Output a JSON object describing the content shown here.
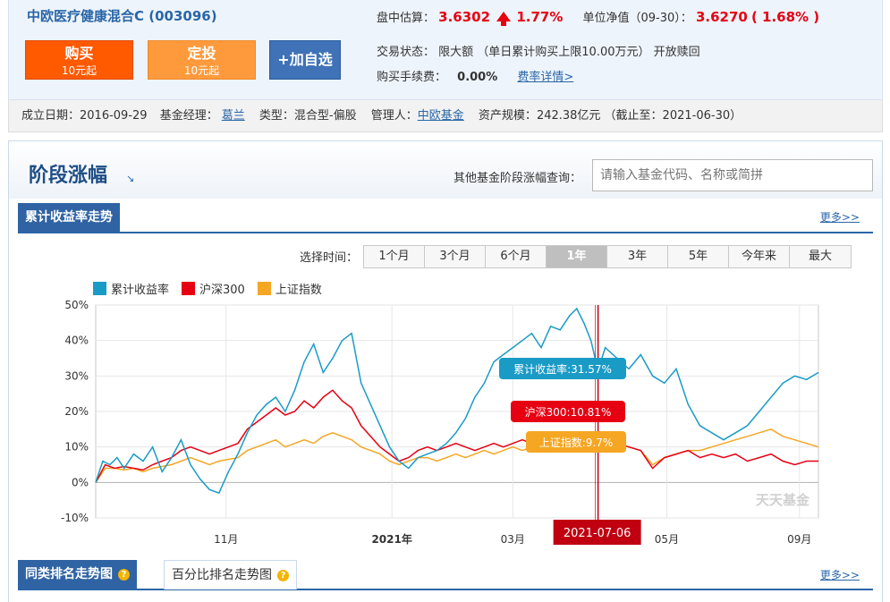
{
  "header": {
    "fund_title": "中欧医疗健康混合C (003096)",
    "buy": {
      "label": "购买",
      "sub": "10元起"
    },
    "sip": {
      "label": "定投",
      "sub": "10元起"
    },
    "add_watch": "+加自选",
    "estimate": {
      "label": "盘中估算：",
      "value": "3.6302",
      "pct": "1.77%"
    },
    "nav": {
      "label": "单位净值（09-30）：",
      "value": "3.6270",
      "pct": "( 1.68% )"
    },
    "trade_status": {
      "label": "交易状态：",
      "value": "限大额 （单日累计购买上限10.00万元） 开放赎回"
    },
    "fee": {
      "label": "购买手续费：",
      "value": "0.00%",
      "link": "费率详情>"
    }
  },
  "subbar": {
    "found_label": "成立日期：",
    "found_value": "2016-09-29",
    "manager_label": "基金经理：",
    "manager_value": "葛兰",
    "type_label": "类型：",
    "type_value": "混合型-偏股",
    "company_label": "管理人：",
    "company_value": "中欧基金",
    "size_label": "资产规模：",
    "size_value": "242.38亿元 （截止至：2021-06-30）"
  },
  "section": {
    "title": "阶段涨幅",
    "title_arrow": "↘",
    "query_label": "其他基金阶段涨幅查询：",
    "query_placeholder": "请输入基金代码、名称或简拼",
    "tab_cumulative": "累计收益率走势",
    "more1": "更多>>",
    "period_label": "选择时间：",
    "periods": [
      "1个月",
      "3个月",
      "6个月",
      "1年",
      "3年",
      "5年",
      "今年来",
      "最大"
    ],
    "active_period": "1年",
    "tab_rank": "同类排名走势图",
    "tab_percent": "百分比排名走势图",
    "more2": "更多>>"
  },
  "colors": {
    "fund": "#1a9bc6",
    "hs300": "#e60012",
    "sz": "#f5a623",
    "accent": "#2f63a3"
  },
  "chart_data": {
    "type": "line",
    "ylim": [
      -10,
      50
    ],
    "yticks": [
      "-10%",
      "0%",
      "10%",
      "20%",
      "30%",
      "40%",
      "50%"
    ],
    "xticks": [
      "11月",
      "2021年",
      "03月",
      "05月",
      "09月"
    ],
    "hover_date": "2021-07-06",
    "watermark": "天天基金",
    "series": [
      {
        "name": "累计收益率",
        "tooltip": "累计收益率:31.57%",
        "points": [
          [
            0,
            0
          ],
          [
            3,
            6
          ],
          [
            6,
            5
          ],
          [
            9,
            7
          ],
          [
            12,
            4
          ],
          [
            16,
            8
          ],
          [
            20,
            6
          ],
          [
            24,
            10
          ],
          [
            28,
            3
          ],
          [
            32,
            7
          ],
          [
            36,
            12
          ],
          [
            40,
            5
          ],
          [
            44,
            1
          ],
          [
            48,
            -2
          ],
          [
            52,
            -3
          ],
          [
            56,
            3
          ],
          [
            60,
            8
          ],
          [
            64,
            14
          ],
          [
            68,
            19
          ],
          [
            72,
            22
          ],
          [
            76,
            24
          ],
          [
            80,
            20
          ],
          [
            84,
            26
          ],
          [
            88,
            34
          ],
          [
            92,
            39
          ],
          [
            96,
            31
          ],
          [
            100,
            35
          ],
          [
            104,
            40
          ],
          [
            108,
            42
          ],
          [
            112,
            28
          ],
          [
            116,
            22
          ],
          [
            120,
            16
          ],
          [
            124,
            10
          ],
          [
            128,
            6
          ],
          [
            132,
            4
          ],
          [
            136,
            7
          ],
          [
            140,
            8
          ],
          [
            144,
            9
          ],
          [
            148,
            11
          ],
          [
            152,
            14
          ],
          [
            156,
            18
          ],
          [
            160,
            24
          ],
          [
            164,
            28
          ],
          [
            168,
            34
          ],
          [
            172,
            36
          ],
          [
            176,
            38
          ],
          [
            180,
            40
          ],
          [
            184,
            42
          ],
          [
            188,
            38
          ],
          [
            192,
            44
          ],
          [
            196,
            43
          ],
          [
            200,
            47
          ],
          [
            203,
            49
          ],
          [
            206,
            45
          ],
          [
            209,
            40
          ],
          [
            212,
            31.5
          ],
          [
            215,
            38
          ],
          [
            220,
            35
          ],
          [
            225,
            32
          ],
          [
            230,
            36
          ],
          [
            235,
            30
          ],
          [
            240,
            28
          ],
          [
            245,
            32
          ],
          [
            250,
            22
          ],
          [
            255,
            16
          ],
          [
            260,
            14
          ],
          [
            265,
            12
          ],
          [
            270,
            14
          ],
          [
            275,
            16
          ],
          [
            280,
            20
          ],
          [
            285,
            24
          ],
          [
            290,
            28
          ],
          [
            295,
            30
          ],
          [
            300,
            29
          ],
          [
            305,
            31
          ]
        ]
      },
      {
        "name": "沪深300",
        "tooltip": "沪深300:10.81%",
        "points": [
          [
            0,
            0
          ],
          [
            4,
            5
          ],
          [
            8,
            4
          ],
          [
            12,
            4.5
          ],
          [
            16,
            4
          ],
          [
            20,
            3.5
          ],
          [
            24,
            5
          ],
          [
            28,
            6
          ],
          [
            32,
            7
          ],
          [
            36,
            9
          ],
          [
            40,
            10
          ],
          [
            44,
            9
          ],
          [
            48,
            8
          ],
          [
            52,
            9
          ],
          [
            56,
            10
          ],
          [
            60,
            11
          ],
          [
            64,
            15
          ],
          [
            68,
            17
          ],
          [
            72,
            19
          ],
          [
            76,
            21
          ],
          [
            80,
            19
          ],
          [
            84,
            20
          ],
          [
            88,
            23
          ],
          [
            92,
            21
          ],
          [
            96,
            24
          ],
          [
            100,
            26
          ],
          [
            104,
            23
          ],
          [
            108,
            21
          ],
          [
            112,
            16
          ],
          [
            116,
            13
          ],
          [
            120,
            10
          ],
          [
            124,
            8
          ],
          [
            128,
            6
          ],
          [
            132,
            7
          ],
          [
            136,
            9
          ],
          [
            140,
            10
          ],
          [
            144,
            9
          ],
          [
            148,
            10
          ],
          [
            152,
            11
          ],
          [
            156,
            10
          ],
          [
            160,
            9
          ],
          [
            164,
            10
          ],
          [
            168,
            11
          ],
          [
            172,
            10
          ],
          [
            176,
            11
          ],
          [
            180,
            12
          ],
          [
            184,
            11
          ],
          [
            188,
            12
          ],
          [
            192,
            11
          ],
          [
            196,
            10
          ],
          [
            200,
            11
          ],
          [
            204,
            12
          ],
          [
            208,
            11
          ],
          [
            212,
            10.8
          ],
          [
            216,
            10
          ],
          [
            220,
            11
          ],
          [
            225,
            10
          ],
          [
            230,
            9
          ],
          [
            235,
            4
          ],
          [
            240,
            7
          ],
          [
            245,
            8
          ],
          [
            250,
            9
          ],
          [
            255,
            7
          ],
          [
            260,
            8
          ],
          [
            265,
            7
          ],
          [
            270,
            8
          ],
          [
            275,
            6
          ],
          [
            280,
            7
          ],
          [
            285,
            8
          ],
          [
            290,
            6
          ],
          [
            295,
            5
          ],
          [
            300,
            6
          ],
          [
            305,
            6
          ]
        ]
      },
      {
        "name": "上证指数",
        "tooltip": "上证指数:9.7%",
        "points": [
          [
            0,
            0
          ],
          [
            4,
            4
          ],
          [
            8,
            4
          ],
          [
            12,
            3.5
          ],
          [
            16,
            4
          ],
          [
            20,
            3
          ],
          [
            24,
            4
          ],
          [
            28,
            4.5
          ],
          [
            32,
            5
          ],
          [
            36,
            6
          ],
          [
            40,
            7
          ],
          [
            44,
            6
          ],
          [
            48,
            5
          ],
          [
            52,
            6
          ],
          [
            56,
            6.5
          ],
          [
            60,
            7
          ],
          [
            64,
            9
          ],
          [
            68,
            10
          ],
          [
            72,
            11
          ],
          [
            76,
            12
          ],
          [
            80,
            10
          ],
          [
            84,
            11
          ],
          [
            88,
            12
          ],
          [
            92,
            11
          ],
          [
            96,
            13
          ],
          [
            100,
            14
          ],
          [
            104,
            13
          ],
          [
            108,
            12
          ],
          [
            112,
            10
          ],
          [
            116,
            9
          ],
          [
            120,
            8
          ],
          [
            124,
            6
          ],
          [
            128,
            5
          ],
          [
            132,
            6
          ],
          [
            136,
            7
          ],
          [
            140,
            7
          ],
          [
            144,
            6
          ],
          [
            148,
            7
          ],
          [
            152,
            8
          ],
          [
            156,
            7
          ],
          [
            160,
            8
          ],
          [
            164,
            9
          ],
          [
            168,
            8
          ],
          [
            172,
            9
          ],
          [
            176,
            10
          ],
          [
            180,
            9
          ],
          [
            184,
            10
          ],
          [
            188,
            11
          ],
          [
            192,
            10
          ],
          [
            196,
            9
          ],
          [
            200,
            10
          ],
          [
            204,
            11
          ],
          [
            208,
            10
          ],
          [
            212,
            9.7
          ],
          [
            216,
            10
          ],
          [
            220,
            11
          ],
          [
            225,
            10
          ],
          [
            230,
            9
          ],
          [
            235,
            5
          ],
          [
            240,
            7
          ],
          [
            245,
            8
          ],
          [
            250,
            9
          ],
          [
            255,
            9
          ],
          [
            260,
            10
          ],
          [
            265,
            11
          ],
          [
            270,
            12
          ],
          [
            275,
            13
          ],
          [
            280,
            14
          ],
          [
            285,
            15
          ],
          [
            290,
            13
          ],
          [
            295,
            12
          ],
          [
            300,
            11
          ],
          [
            305,
            10
          ]
        ]
      }
    ]
  }
}
